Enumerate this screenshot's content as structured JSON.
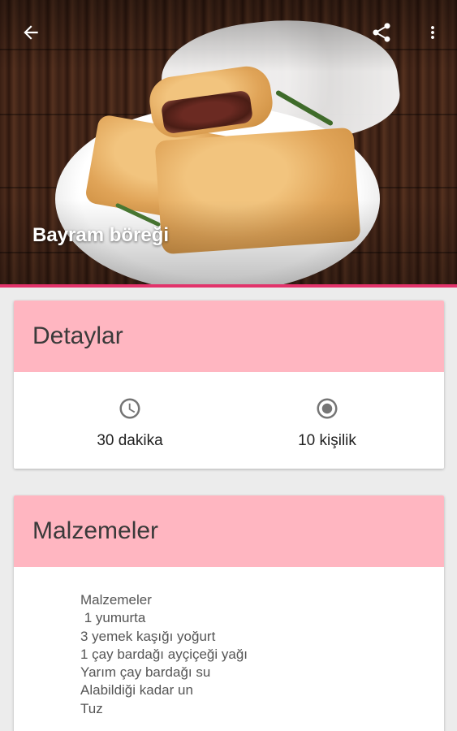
{
  "header": {
    "title": "Bayram böreği",
    "icons": {
      "back": "arrow-back-icon",
      "share": "share-icon",
      "more": "more-vert-icon"
    }
  },
  "colors": {
    "accent": "#e2336b",
    "card_header": "#ffb6c1",
    "background": "#ececec"
  },
  "details": {
    "title": "Detaylar",
    "time": {
      "icon": "clock-icon",
      "text": "30 dakika"
    },
    "servings": {
      "icon": "radio-circle-icon",
      "text": "10 kişilik"
    }
  },
  "ingredients": {
    "title": "Malzemeler",
    "lines": [
      "Malzemeler",
      " 1 yumurta",
      "3 yemek kaşığı yoğurt",
      "1 çay bardağı ayçiçeği yağı",
      "Yarım çay bardağı su",
      "Alabildiği kadar un",
      "Tuz"
    ]
  }
}
